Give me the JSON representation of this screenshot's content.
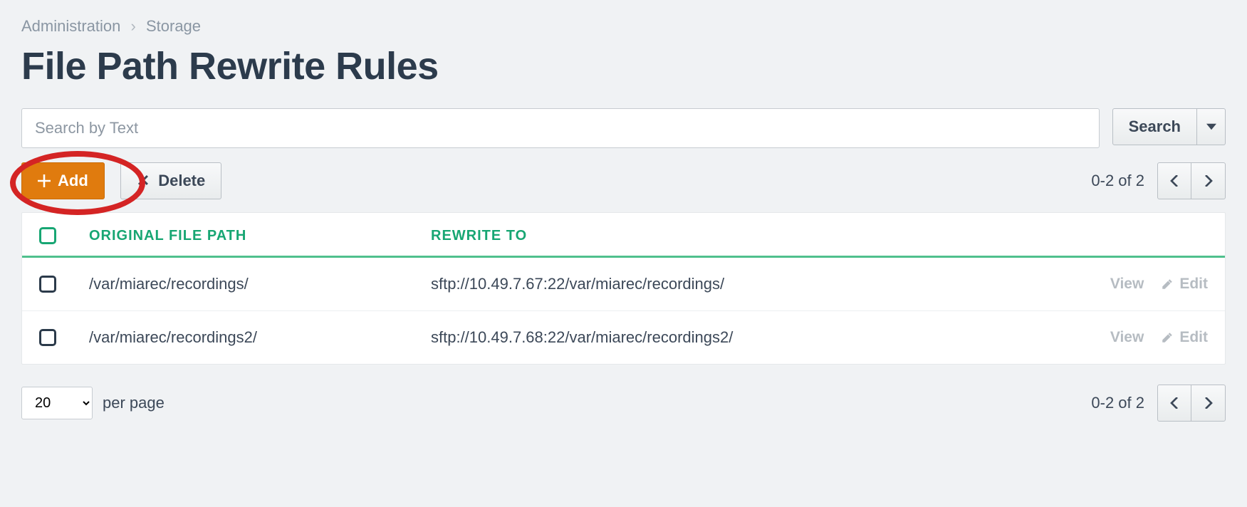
{
  "breadcrumb": {
    "level1": "Administration",
    "level2": "Storage"
  },
  "page_title": "File Path Rewrite Rules",
  "search": {
    "placeholder": "Search by Text",
    "button_label": "Search"
  },
  "toolbar": {
    "add_label": "Add",
    "delete_label": "Delete"
  },
  "pagination": {
    "range_text": "0-2 of 2"
  },
  "table": {
    "headers": {
      "original": "ORIGINAL FILE PATH",
      "rewrite": "REWRITE TO"
    },
    "rows": [
      {
        "original": "/var/miarec/recordings/",
        "rewrite": "sftp://10.49.7.67:22/var/miarec/recordings/"
      },
      {
        "original": "/var/miarec/recordings2/",
        "rewrite": "sftp://10.49.7.68:22/var/miarec/recordings2/"
      }
    ],
    "actions": {
      "view": "View",
      "edit": "Edit"
    }
  },
  "footer": {
    "per_page_value": "20",
    "per_page_label": "per page",
    "range_text": "0-2 of 2"
  }
}
